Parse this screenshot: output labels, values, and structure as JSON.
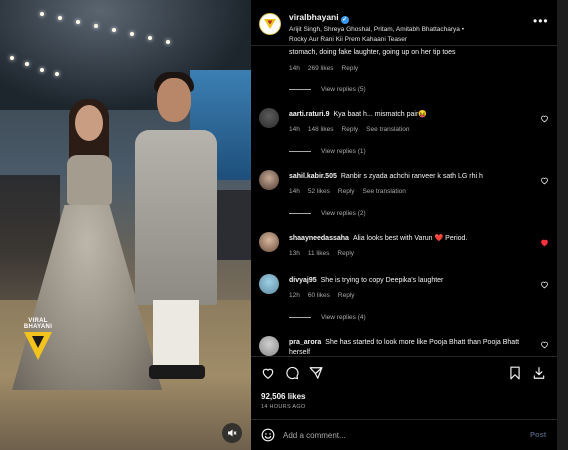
{
  "post": {
    "username": "viralbhayani",
    "audio": "Arijit Singh, Shreya Ghoshal, Pritam, Amitabh Bhattacharya •",
    "audio_line2": "Rocky Aur Rani Kii Prem Kahaani Teaser",
    "likes": "92,506 likes",
    "date": "14 HOURS AGO",
    "watermark": "VIRAL BHAYANI"
  },
  "comments": [
    {
      "user": "",
      "text": "stomach, doing fake laughter, going up on her tip toes",
      "time": "14h",
      "likes": "269 likes",
      "reply": "Reply",
      "see_translation": "",
      "replies": "View replies (5)",
      "liked": false
    },
    {
      "user": "aarti.raturi.9",
      "text": "Kya baat h... mismatch pair😝",
      "time": "14h",
      "likes": "148 likes",
      "reply": "Reply",
      "see_translation": "See translation",
      "replies": "View replies (1)",
      "liked": false
    },
    {
      "user": "sahil.kabir.505",
      "text": "Ranbir s zyada achchi ranveer k sath LG rhi h",
      "time": "14h",
      "likes": "52 likes",
      "reply": "Reply",
      "see_translation": "See translation",
      "replies": "View replies (2)",
      "liked": false
    },
    {
      "user": "shaayneedassaha",
      "text": "Alia looks best with Varun ❤️ Period.",
      "time": "13h",
      "likes": "11 likes",
      "reply": "Reply",
      "see_translation": "",
      "replies": "",
      "liked": true
    },
    {
      "user": "divyaj95",
      "text": "She is trying to copy Deepika's laughter",
      "time": "12h",
      "likes": "60 likes",
      "reply": "Reply",
      "see_translation": "",
      "replies": "View replies (4)",
      "liked": false
    },
    {
      "user": "pra_arora",
      "text": "She has started to look more like Pooja Bhatt than Pooja Bhatt herself",
      "time": "",
      "likes": "",
      "reply": "",
      "see_translation": "",
      "replies": "",
      "liked": false
    }
  ],
  "composer": {
    "placeholder": "Add a comment...",
    "post_label": "Post"
  },
  "colors": {
    "background": "#000000",
    "text": "#f5f5f5",
    "muted": "#a8a8a8",
    "like_red": "#ff3040",
    "verified_blue": "#3897f0",
    "post_disabled": "#4a5a73"
  }
}
